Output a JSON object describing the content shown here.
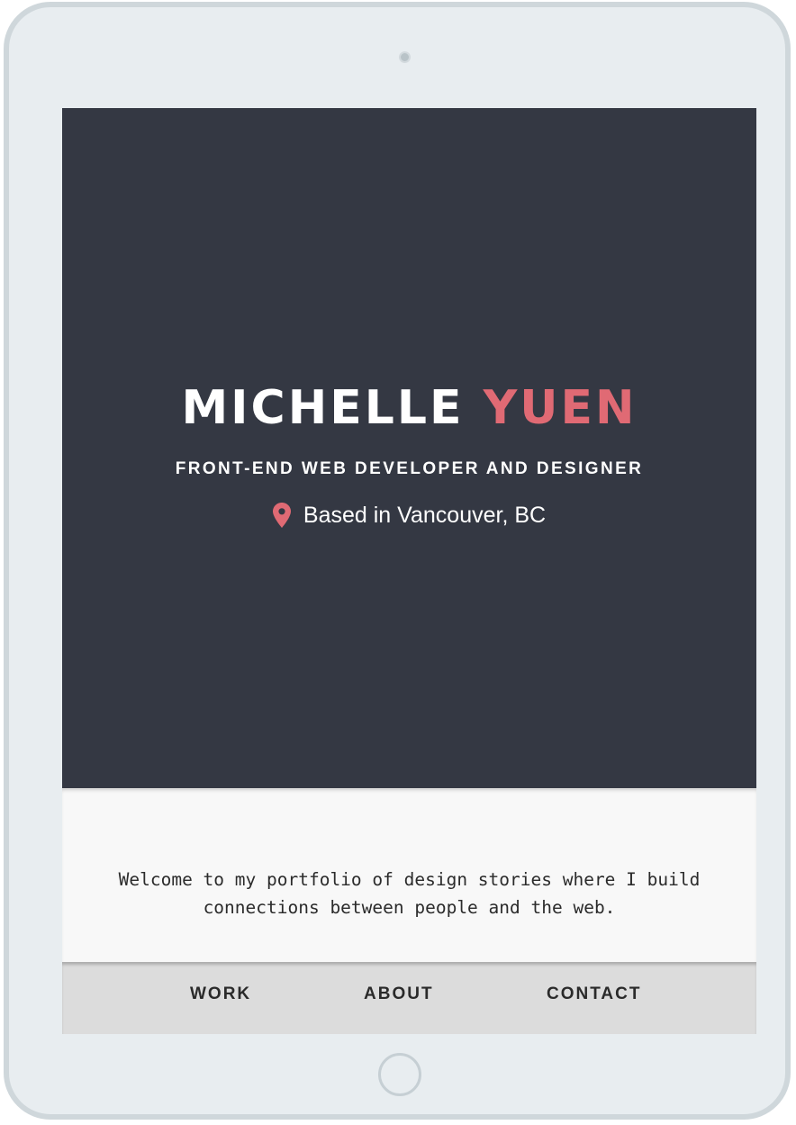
{
  "hero": {
    "first_name": "MICHELLE",
    "last_name": "YUEN",
    "subtitle": "FRONT-END WEB DEVELOPER AND DESIGNER",
    "location": "Based in Vancouver, BC",
    "location_icon": "map-pin-icon"
  },
  "intro": {
    "text": "Welcome to my portfolio of design stories where I build connections between people and the web."
  },
  "nav": {
    "items": [
      {
        "label": "WORK"
      },
      {
        "label": "ABOUT"
      },
      {
        "label": "CONTACT"
      }
    ]
  },
  "colors": {
    "hero_background": "#343843",
    "accent": "#e06a74",
    "nav_background": "#dcdcdc",
    "intro_background": "#f8f8f8",
    "device_frame": "#e8edf0"
  }
}
